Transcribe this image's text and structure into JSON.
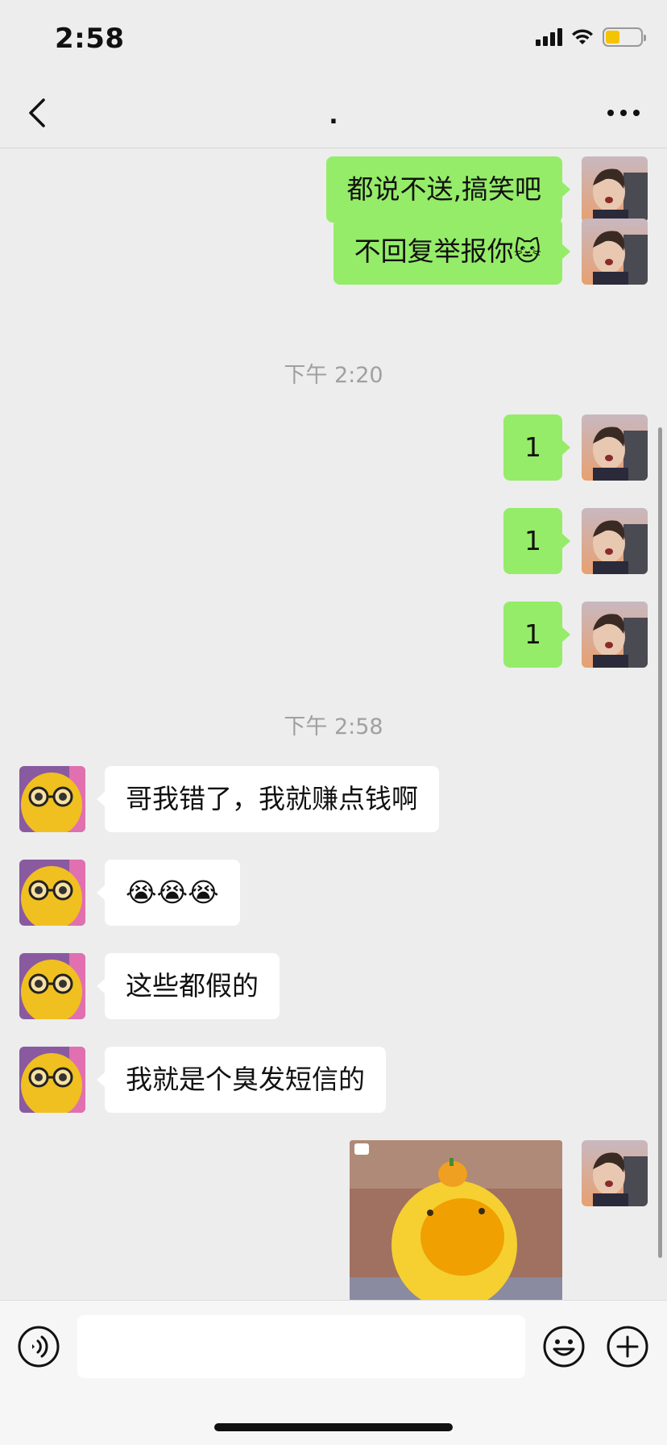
{
  "status_bar": {
    "time": "2:58",
    "icons": [
      "signal-icon",
      "wifi-icon",
      "battery-icon"
    ],
    "battery_color": "#f5c400"
  },
  "nav": {
    "title": ".",
    "back_icon": "chevron-left-icon",
    "more_icon": "more-icon"
  },
  "colors": {
    "sent_bubble": "#95ec69",
    "received_bubble": "#ffffff",
    "background": "#ededed"
  },
  "messages": [
    {
      "side": "right",
      "text": "都说不送,搞笑吧"
    },
    {
      "side": "right",
      "text": "不回复举报你🐱"
    },
    {
      "type": "timestamp",
      "text": "下午 2:20"
    },
    {
      "side": "right",
      "text": "1"
    },
    {
      "side": "right",
      "text": "1"
    },
    {
      "side": "right",
      "text": "1"
    },
    {
      "type": "timestamp",
      "text": "下午 2:58"
    },
    {
      "side": "left",
      "text": "哥我错了，我就赚点钱啊"
    },
    {
      "side": "left",
      "text": "😭😭😭"
    },
    {
      "side": "left",
      "text": "这些都假的"
    },
    {
      "side": "left",
      "text": "我就是个臭发短信的"
    },
    {
      "side": "right",
      "type": "image",
      "icon": "sticker-image-icon"
    }
  ],
  "input_bar": {
    "value": "",
    "voice_icon": "voice-icon",
    "emoji_icon": "emoji-icon",
    "plus_icon": "plus-icon"
  }
}
